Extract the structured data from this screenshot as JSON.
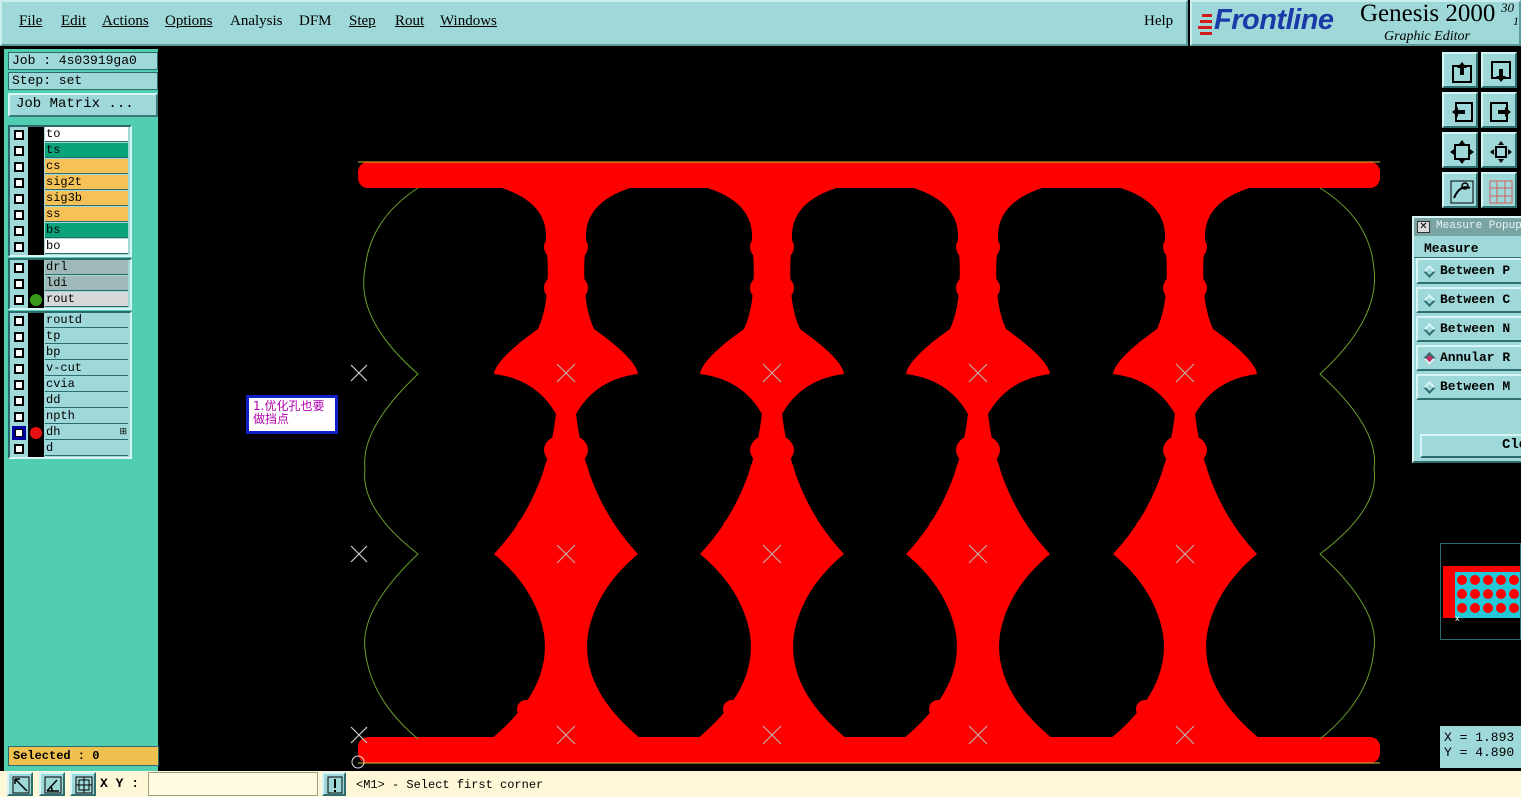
{
  "menu": {
    "items": [
      "File",
      "Edit",
      "Actions",
      "Options",
      "Analysis",
      "DFM",
      "Step",
      "Rout",
      "Windows"
    ],
    "help": "Help"
  },
  "brand": {
    "logo": "Frontline",
    "title": "Genesis 2000",
    "version": "30",
    "version_line2": "1",
    "subtitle": "Graphic Editor"
  },
  "job": {
    "job_label": "Job : 4s03919ga0",
    "step_label": "Step: set",
    "matrix_button": "Job Matrix ..."
  },
  "layers": {
    "group1": [
      {
        "name": "to",
        "color": "#ffffff",
        "dot": null
      },
      {
        "name": "ts",
        "color": "#0aa37a",
        "dot": null
      },
      {
        "name": "cs",
        "color": "#f6c257",
        "dot": null
      },
      {
        "name": "sig2t",
        "color": "#f6c257",
        "dot": null
      },
      {
        "name": "sig3b",
        "color": "#f6c257",
        "dot": null
      },
      {
        "name": "ss",
        "color": "#f6c257",
        "dot": null
      },
      {
        "name": "bs",
        "color": "#0aa37a",
        "dot": null
      },
      {
        "name": "bo",
        "color": "#ffffff",
        "dot": null
      }
    ],
    "group2": [
      {
        "name": "drl",
        "color": "#9fb8b8",
        "dot": null
      },
      {
        "name": "ldi",
        "color": "#9fb8b8",
        "dot": null
      },
      {
        "name": "rout",
        "color": "#d8d8d8",
        "dot": "#3a9a1a"
      }
    ],
    "group3": [
      {
        "name": "routd",
        "color": "#9fd8d8",
        "dot": null
      },
      {
        "name": "tp",
        "color": "#9fd8d8",
        "dot": null
      },
      {
        "name": "bp",
        "color": "#9fd8d8",
        "dot": null
      },
      {
        "name": "v-cut",
        "color": "#9fd8d8",
        "dot": null
      },
      {
        "name": "cvia",
        "color": "#9fd8d8",
        "dot": null
      },
      {
        "name": "dd",
        "color": "#9fd8d8",
        "dot": null
      },
      {
        "name": "npth",
        "color": "#9fd8d8",
        "dot": null
      },
      {
        "name": "dh",
        "color": "#9fd8d8",
        "dot": "#e81010",
        "active": true,
        "mark": "⊞"
      },
      {
        "name": "d",
        "color": "#9fd8d8",
        "dot": null
      }
    ]
  },
  "selected": "Selected : 0",
  "canvas": {
    "note": "1.优化孔也要做挡点",
    "fill_color": "#ff0000",
    "outline_color": "#6aa02a"
  },
  "tools": {
    "buttons": [
      "pan-up-icon",
      "pan-down-icon",
      "pan-left-icon",
      "pan-right-icon",
      "zoom-fit-icon",
      "zoom-home-icon",
      "snap-icon",
      "grid-icon"
    ]
  },
  "measure": {
    "title": "Measure Popup",
    "heading": "Measure",
    "options": [
      {
        "label": "Between P",
        "selected": false
      },
      {
        "label": "Between C",
        "selected": false
      },
      {
        "label": "Between N",
        "selected": false
      },
      {
        "label": "Annular R",
        "selected": true
      },
      {
        "label": "Between M",
        "selected": false
      }
    ],
    "close": "Close"
  },
  "coords": {
    "x": "X = 1.893",
    "y": "Y = 4.890"
  },
  "bottom": {
    "xy_label": "X Y :",
    "xy_value": "",
    "exclaim": "!",
    "status": "<M1> - Select first corner"
  }
}
